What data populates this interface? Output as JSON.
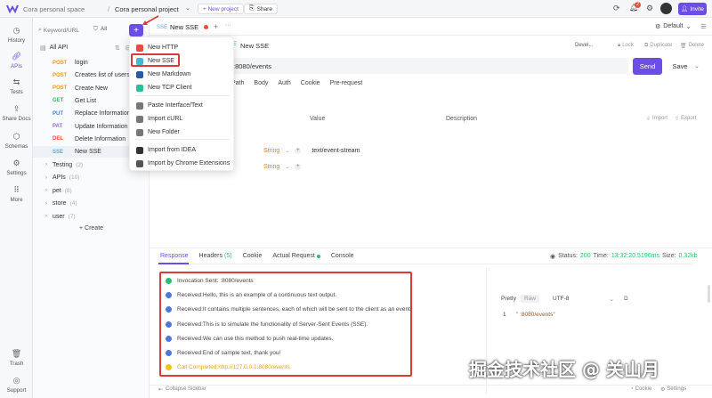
{
  "topbar": {
    "workspace": "Cora personal space",
    "separator": "/",
    "project": "Cora personal project",
    "new_project": "+ New project",
    "share": "Share",
    "notif_count": "2",
    "invite": "Invite"
  },
  "nav": {
    "history": "History",
    "apis": "APIs",
    "tests": "Tests",
    "share_docs": "Share Docs",
    "schemas": "Schemas",
    "settings": "Settings",
    "more": "More",
    "trash": "Trash",
    "support": "Support"
  },
  "sidebar": {
    "search_placeholder": "Keyword/URL",
    "filter_label": "All",
    "all_api": "All API",
    "apis": [
      {
        "method": "POST",
        "name": "login",
        "color": "#f39c12"
      },
      {
        "method": "POST",
        "name": "Creates list of users w",
        "color": "#f39c12"
      },
      {
        "method": "POST",
        "name": "Create New",
        "color": "#f39c12"
      },
      {
        "method": "GET",
        "name": "Get List",
        "color": "#2bbf6a"
      },
      {
        "method": "PUT",
        "name": "Replace Information",
        "color": "#4a7bd6"
      },
      {
        "method": "PAT",
        "name": "Update Information",
        "color": "#8e6bd8"
      },
      {
        "method": "DEL",
        "name": "Delete Information",
        "color": "#e74c3c"
      },
      {
        "method": "SSE",
        "name": "New SSE",
        "color": "#45b7d1"
      }
    ],
    "folders": [
      {
        "name": "Testing",
        "count": "(2)"
      },
      {
        "name": "APIs",
        "count": "(10)"
      },
      {
        "name": "pet",
        "count": "(8)"
      },
      {
        "name": "store",
        "count": "(4)"
      },
      {
        "name": "user",
        "count": "(7)"
      }
    ],
    "create": "+ Create"
  },
  "tabs": {
    "active_tag": "SSE",
    "active_label": "New SSE",
    "plus": "+",
    "more": "···",
    "env": "Default"
  },
  "request": {
    "tag": "SSE",
    "name": "New SSE",
    "env_label": "Devel...",
    "lock": "Lock",
    "duplicate": "Duplicate",
    "delete": "Delete",
    "url": ":8080/events",
    "send": "Send",
    "save": "Save",
    "subtabs": [
      "Path",
      "Body",
      "Auth",
      "Cookie",
      "Pre-request"
    ],
    "col_value": "Value",
    "col_desc": "Description",
    "import": "Import",
    "export": "Export",
    "rows": [
      {
        "type": "String",
        "value": "text/event-stream"
      },
      {
        "type": "String",
        "value": ""
      }
    ]
  },
  "menu": {
    "items": [
      {
        "label": "New HTTP",
        "color": "#e74c3c"
      },
      {
        "label": "New SSE",
        "color": "#45b7d1"
      },
      {
        "label": "New Markdown",
        "color": "#2c5aa0"
      },
      {
        "label": "New TCP Client",
        "color": "#2bbf9a"
      },
      {
        "label": "Paste Interface/Text",
        "color": "#777"
      },
      {
        "label": "Import cURL",
        "color": "#777"
      },
      {
        "label": "New Folder",
        "color": "#777"
      },
      {
        "label": "Import from IDEA",
        "color": "#333"
      },
      {
        "label": "Import by Chrome Extensions",
        "color": "#555"
      }
    ]
  },
  "response": {
    "tabs": [
      "Response",
      "Headers",
      "Cookie",
      "Actual Request",
      "Console"
    ],
    "headers_count": "(5)",
    "status_label": "Status:",
    "status_value": "200",
    "time_label": "Time:",
    "time_value": "13:32:20.5196ms",
    "size_label": "Size:",
    "size_value": "0.32kb",
    "events": [
      {
        "text": "Invocation Sent:            :8080/events",
        "kind": "sent"
      },
      {
        "text": "Received:Hello, this is an example of a continuous text output.",
        "kind": "recv"
      },
      {
        "text": "Received:It contains multiple sentences, each of which will be sent to the client as an event.",
        "kind": "recv"
      },
      {
        "text": "Received:This is to simulate the functionality of Server-Sent Events (SSE).",
        "kind": "recv"
      },
      {
        "text": "Received:We can use this method to push real-time updates.",
        "kind": "recv"
      },
      {
        "text": "Received:End of sample text, thank you!",
        "kind": "recv"
      },
      {
        "text": "Call Completed:http://127.0.0.1:8080/events",
        "kind": "done"
      }
    ],
    "pretty": "Pretty",
    "raw": "Raw",
    "encoding": "UTF-8",
    "line_no": "1",
    "line_text": "\"          :8080/events\""
  },
  "footer": {
    "collapse": "Collapse Sidebar",
    "cookie": "Cookie",
    "settings": "Settings",
    "watermark": "掘金技术社区 @ 关山月"
  },
  "colors": {
    "accent": "#6c4ee6",
    "highlight_box": "#d93a3a"
  }
}
